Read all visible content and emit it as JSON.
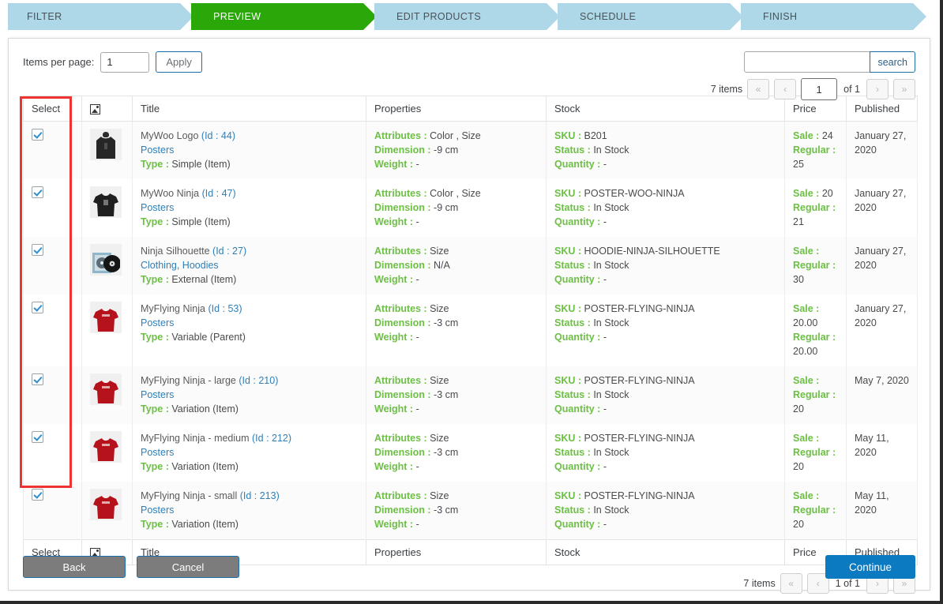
{
  "steps": [
    {
      "label": "FILTER",
      "active": false
    },
    {
      "label": "PREVIEW",
      "active": true
    },
    {
      "label": "EDIT PRODUCTS",
      "active": false
    },
    {
      "label": "SCHEDULE",
      "active": false
    },
    {
      "label": "FINISH",
      "active": false
    }
  ],
  "toolbar": {
    "items_per_page_label": "Items per page:",
    "items_per_page_value": "1",
    "apply_label": "Apply",
    "search_value": "",
    "search_placeholder": "",
    "search_label": "search"
  },
  "pager_top": {
    "items_text": "7 items",
    "first": "«",
    "prev": "‹",
    "page_value": "1",
    "of_text": "of 1",
    "next": "›",
    "last": "»"
  },
  "pager_bottom": {
    "items_text": "7 items",
    "first": "«",
    "prev": "‹",
    "page_text": "1 of 1",
    "next": "›",
    "last": "»"
  },
  "columns": {
    "select": "Select",
    "image": "image-icon",
    "title": "Title",
    "properties": "Properties",
    "stock": "Stock",
    "price": "Price",
    "published": "Published"
  },
  "labels": {
    "attributes": "Attributes :",
    "dimension": "Dimension :",
    "weight": "Weight :",
    "sku": "SKU :",
    "status": "Status :",
    "quantity": "Quantity :",
    "sale": "Sale :",
    "regular": "Regular :",
    "type": "Type :"
  },
  "rows": [
    {
      "selected": true,
      "thumb": "hoodie-black",
      "title": "MyWoo Logo",
      "id": "(Id : 44)",
      "id_num": "44",
      "category": "Posters",
      "type": "Simple (Item)",
      "attributes": "Color , Size",
      "dimension": "-9 cm",
      "weight": "-",
      "sku": "B201",
      "status": "In Stock",
      "quantity": "-",
      "sale": "24",
      "regular": "25",
      "published": "January 27, 2020"
    },
    {
      "selected": true,
      "thumb": "tshirt-black",
      "title": "MyWoo Ninja",
      "id": "(Id : 47)",
      "id_num": "47",
      "category": "Posters",
      "type": "Simple (Item)",
      "attributes": "Color , Size",
      "dimension": "-9 cm",
      "weight": "-",
      "sku": "POSTER-WOO-NINJA",
      "status": "In Stock",
      "quantity": "-",
      "sale": "20",
      "regular": "21",
      "published": "January 27, 2020"
    },
    {
      "selected": true,
      "thumb": "vinyl-record",
      "title": "Ninja Silhouette",
      "id": "(Id : 27)",
      "id_num": "27",
      "category": "Clothing, Hoodies",
      "type": "External (Item)",
      "attributes": "Size",
      "dimension": "N/A",
      "weight": "-",
      "sku": "HOODIE-NINJA-SILHOUETTE",
      "status": "In Stock",
      "quantity": "-",
      "sale": "",
      "regular": "30",
      "published": "January 27, 2020"
    },
    {
      "selected": true,
      "thumb": "tshirt-red",
      "title": "MyFlying Ninja",
      "id": "(Id : 53)",
      "id_num": "53",
      "category": "Posters",
      "type": "Variable (Parent)",
      "attributes": "Size",
      "dimension": "-3 cm",
      "weight": "-",
      "sku": "POSTER-FLYING-NINJA",
      "status": "In Stock",
      "quantity": "-",
      "sale": "20.00",
      "regular": "20.00",
      "published": "January 27, 2020"
    },
    {
      "selected": true,
      "thumb": "tshirt-red",
      "title": "MyFlying Ninja - large",
      "id": "(Id : 210)",
      "id_num": "210",
      "category": "Posters",
      "type": "Variation (Item)",
      "attributes": "Size",
      "dimension": "-3 cm",
      "weight": "-",
      "sku": "POSTER-FLYING-NINJA",
      "status": "In Stock",
      "quantity": "-",
      "sale": "",
      "regular": "20",
      "published": "May 7, 2020"
    },
    {
      "selected": true,
      "thumb": "tshirt-red",
      "title": "MyFlying Ninja - medium",
      "id": "(Id : 212)",
      "id_num": "212",
      "category": "Posters",
      "type": "Variation (Item)",
      "attributes": "Size",
      "dimension": "-3 cm",
      "weight": "-",
      "sku": "POSTER-FLYING-NINJA",
      "status": "In Stock",
      "quantity": "-",
      "sale": "",
      "regular": "20",
      "published": "May 11, 2020"
    },
    {
      "selected": true,
      "thumb": "tshirt-red",
      "title": "MyFlying Ninja - small",
      "id": "(Id : 213)",
      "id_num": "213",
      "category": "Posters",
      "type": "Variation (Item)",
      "attributes": "Size",
      "dimension": "-3 cm",
      "weight": "-",
      "sku": "POSTER-FLYING-NINJA",
      "status": "In Stock",
      "quantity": "-",
      "sale": "",
      "regular": "20",
      "published": "May 11, 2020"
    }
  ],
  "footer": {
    "back_label": "Back",
    "cancel_label": "Cancel",
    "continue_label": "Continue"
  },
  "colors": {
    "active_step": "#2aa80a",
    "inactive_step": "#aed7e8",
    "accent_green": "#6cc044",
    "link_blue": "#2e7fb8",
    "primary_blue": "#0b7ac0",
    "annotation_red": "#ef3333"
  }
}
